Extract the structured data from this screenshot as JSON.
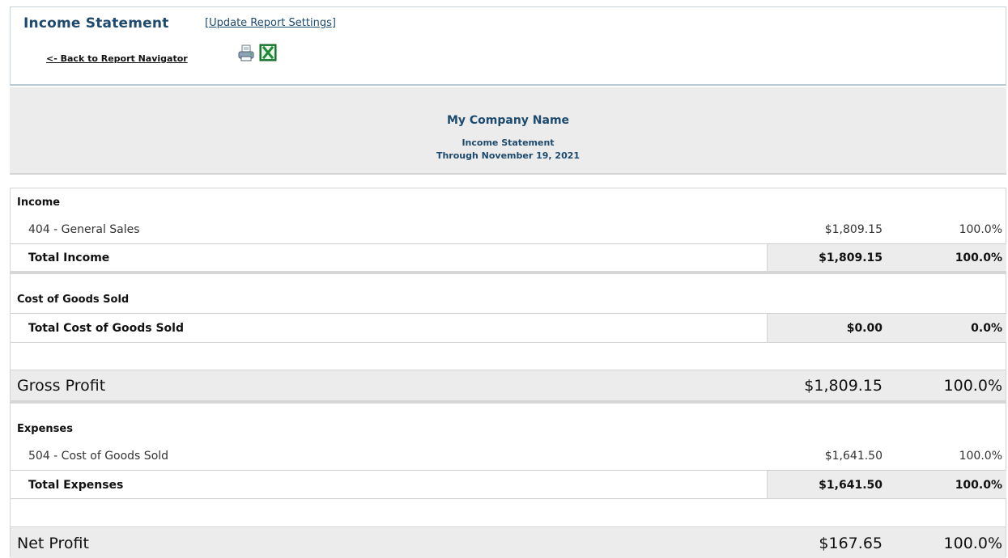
{
  "header": {
    "title": "Income Statement",
    "update_settings_label": "Update Report Settings",
    "back_link": "<- Back to Report Navigator"
  },
  "company": {
    "name": "My Company Name",
    "report_name": "Income Statement",
    "report_period": "Through November 19, 2021"
  },
  "income": {
    "heading": "Income",
    "items": [
      {
        "label": "404 - General Sales",
        "amount": "$1,809.15",
        "percent": "100.0%"
      }
    ],
    "total": {
      "label": "Total Income",
      "amount": "$1,809.15",
      "percent": "100.0%"
    }
  },
  "cogs": {
    "heading": "Cost of Goods Sold",
    "total": {
      "label": "Total Cost of Goods Sold",
      "amount": "$0.00",
      "percent": "0.0%"
    }
  },
  "gross_profit": {
    "label": "Gross Profit",
    "amount": "$1,809.15",
    "percent": "100.0%"
  },
  "expenses": {
    "heading": "Expenses",
    "items": [
      {
        "label": "504 - Cost of Goods Sold",
        "amount": "$1,641.50",
        "percent": "100.0%"
      }
    ],
    "total": {
      "label": "Total Expenses",
      "amount": "$1,641.50",
      "percent": "100.0%"
    }
  },
  "net_profit": {
    "label": "Net Profit",
    "amount": "$167.65",
    "percent": "100.0%"
  },
  "icons": {
    "print": "print-icon",
    "excel": "excel-export-icon"
  },
  "colors": {
    "title": "#1d4a6e",
    "shade": "#ececec",
    "excel_green": "#1f8b3a"
  }
}
